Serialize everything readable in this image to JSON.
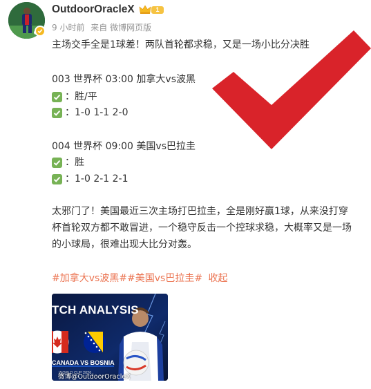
{
  "user": {
    "name": "OutdoorOracleX",
    "level": "1"
  },
  "meta": {
    "time": "9 小时前",
    "source": "来自 微博网页版"
  },
  "post": {
    "intro": "主场交手全是1球差！两队首轮都求稳，又是一场小比分决胜",
    "match1": {
      "header": "003 世界杯 03:00 加拿大vs波黑",
      "pick1": "：胜/平",
      "pick2": "：1-0 1-1 2-0"
    },
    "match2": {
      "header": "004 世界杯 09:00 美国vs巴拉圭",
      "pick1": "：胜",
      "pick2": "：1-0 2-1 2-1"
    },
    "analysis": [
      "太邪门了！美国最近三次主场打巴拉圭，全是刚好赢1球，从来没打穿",
      "杯首轮双方都不敢冒进，一个稳守反击一个控球求稳，大概率又是一场",
      "的小球局，很难出现大比分对轰。"
    ],
    "hashtags": [
      "#加拿大vs波黑#",
      "#美国vs巴拉圭#"
    ],
    "collapse": "收起"
  },
  "image": {
    "title": "TCH ANALYSIS",
    "subtitle": "CANADA VS BOSNIA",
    "event": "WORLD CUP 2026",
    "watermark": "微博@OutdoorOracleX"
  },
  "icons": {
    "crown": "crown-icon",
    "verified": "verified-badge-icon",
    "check": "check-mark-icon",
    "big_check": "red-check-mark"
  },
  "colors": {
    "accent": "#eb7350",
    "check_green": "#77b255",
    "big_check_red": "#d9232a",
    "meta_gray": "#939393"
  }
}
